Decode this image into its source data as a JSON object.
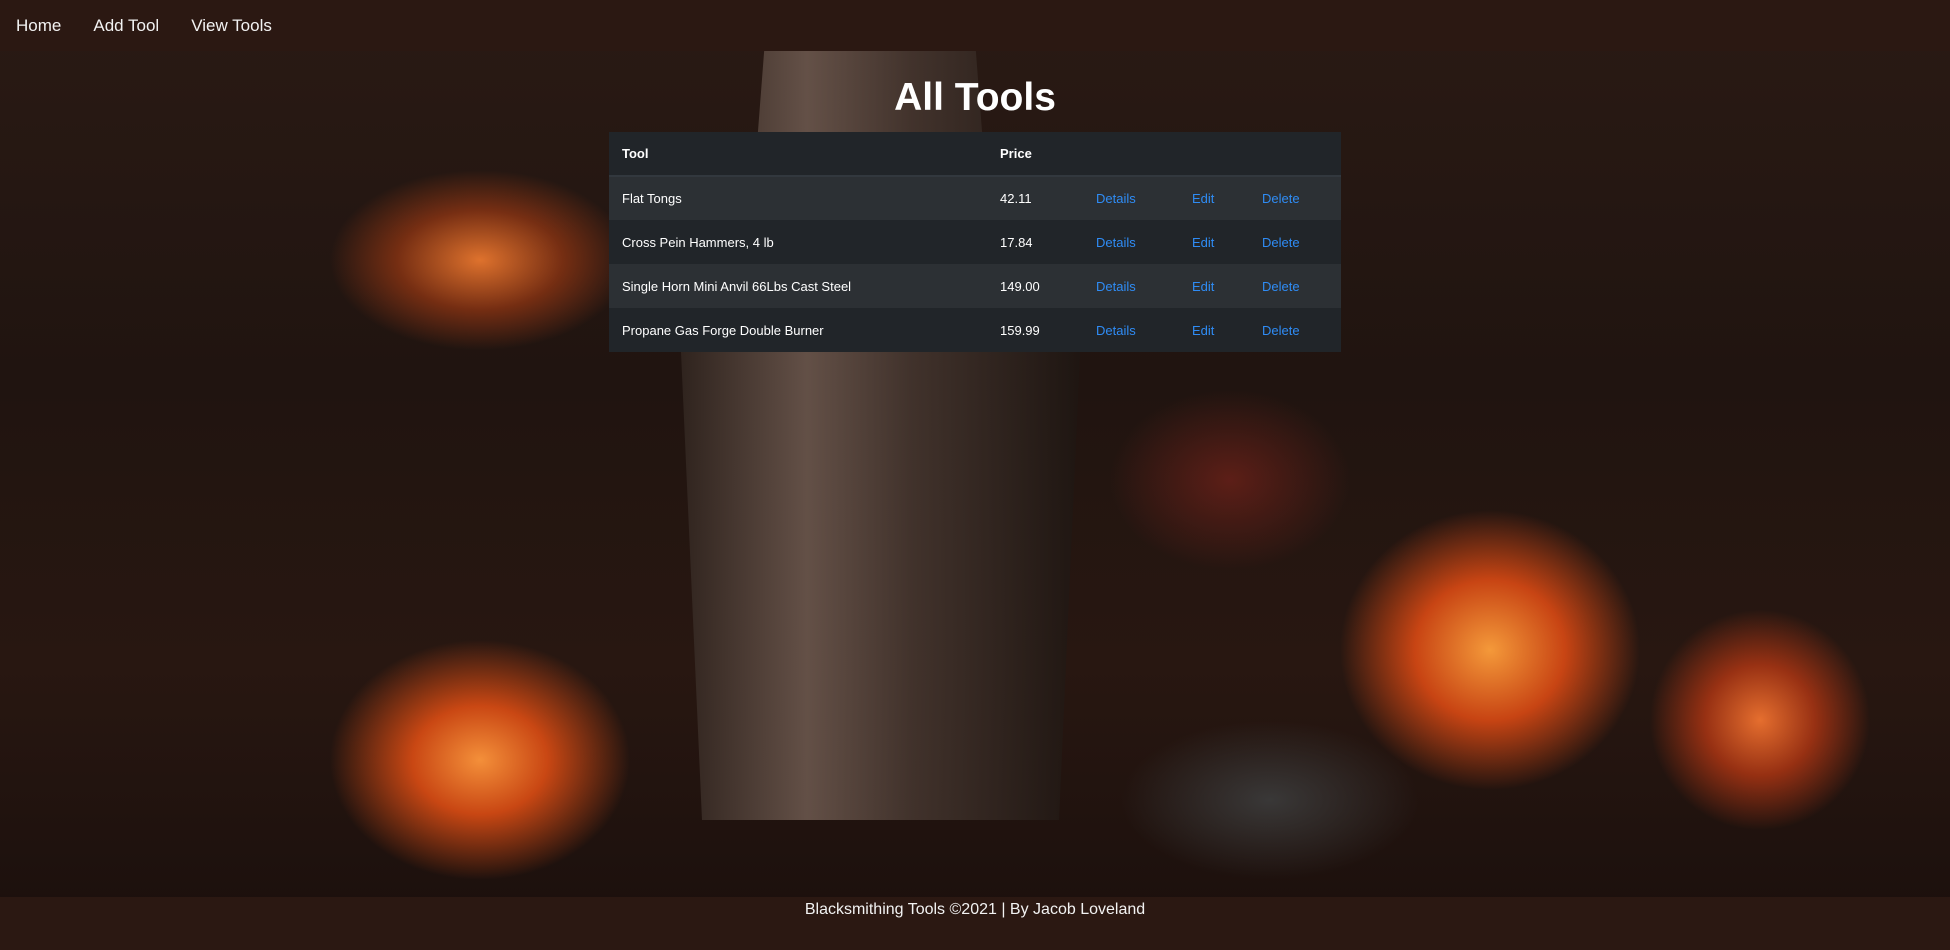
{
  "nav": {
    "items": [
      {
        "label": "Home"
      },
      {
        "label": "Add Tool"
      },
      {
        "label": "View Tools"
      }
    ]
  },
  "page": {
    "title": "All Tools"
  },
  "table": {
    "headers": {
      "tool": "Tool",
      "price": "Price"
    },
    "rows": [
      {
        "tool": "Flat Tongs",
        "price": "42.11",
        "details": "Details",
        "edit": "Edit",
        "delete": "Delete"
      },
      {
        "tool": "Cross Pein Hammers, 4 lb",
        "price": "17.84",
        "details": "Details",
        "edit": "Edit",
        "delete": "Delete"
      },
      {
        "tool": "Single Horn Mini Anvil 66Lbs Cast Steel",
        "price": "149.00",
        "details": "Details",
        "edit": "Edit",
        "delete": "Delete"
      },
      {
        "tool": "Propane Gas Forge Double Burner",
        "price": "159.99",
        "details": "Details",
        "edit": "Edit",
        "delete": "Delete"
      }
    ]
  },
  "footer": {
    "text": "Blacksmithing Tools ©2021 | By Jacob Loveland"
  },
  "colors": {
    "navbar_bg": "#2b1812",
    "table_dark": "#212529",
    "table_stripe": "#2c3034",
    "link": "#2f8cf5"
  }
}
